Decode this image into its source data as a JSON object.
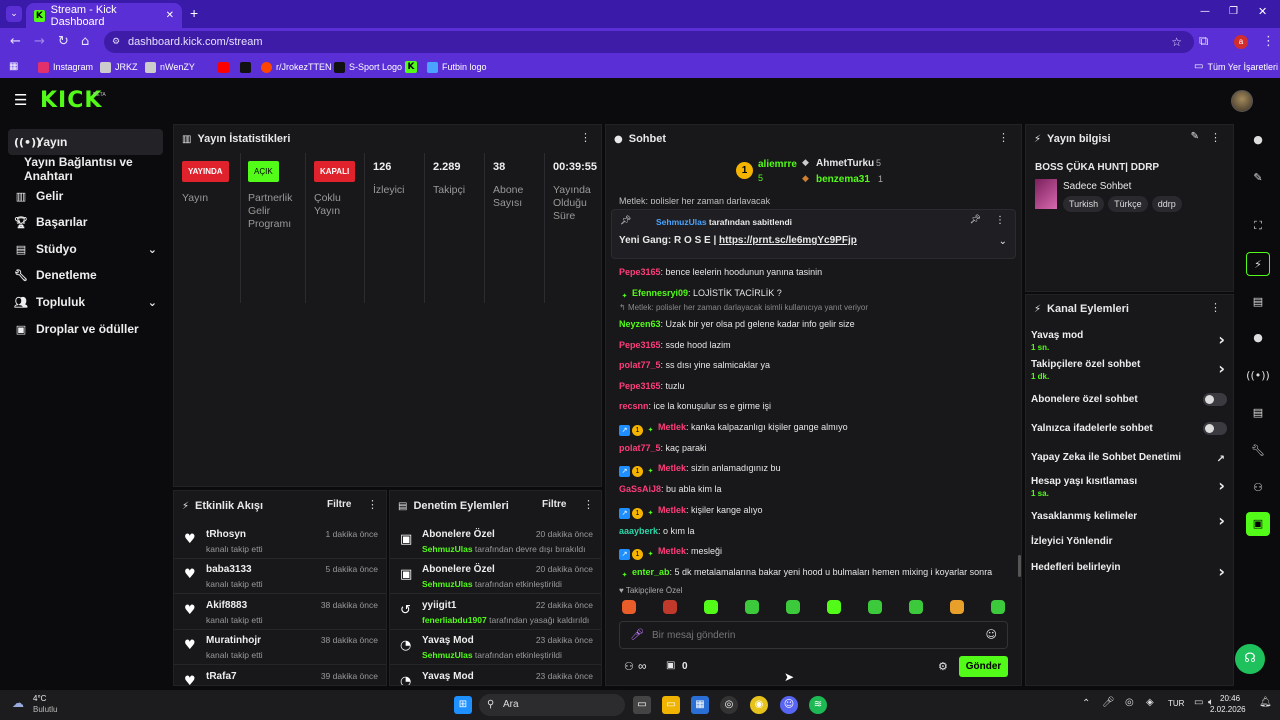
{
  "browser": {
    "tab_title": "Stream - Kick Dashboard",
    "new_tab": "+",
    "url": "dashboard.kick.com/stream",
    "profile_initial": "a",
    "bookmarks": [
      "Instagram",
      "JRKZ",
      "nWenZY",
      "r/JrokezTTEN",
      "S-Sport Logo",
      "Futbin logo"
    ],
    "all_bookmarks": "Tüm Yer İşaretleri"
  },
  "app": {
    "logo": "KICK",
    "beta": "BETA"
  },
  "sidebar": {
    "items": [
      {
        "label": "Yayın",
        "icon": "stream-icon"
      },
      {
        "label": "Yayın Bağlantısı ve Anahtarı",
        "icon": ""
      },
      {
        "label": "Gelir",
        "icon": "revenue-icon"
      },
      {
        "label": "Başarılar",
        "icon": "trophy-icon"
      },
      {
        "label": "Stüdyo",
        "icon": "studio-icon"
      },
      {
        "label": "Denetleme",
        "icon": "wrench-icon"
      },
      {
        "label": "Topluluk",
        "icon": "community-icon"
      },
      {
        "label": "Droplar ve ödüller",
        "icon": "gift-icon"
      }
    ]
  },
  "stats": {
    "title": "Yayın İstatistikleri",
    "cols": [
      {
        "badge": "YAYINDA",
        "badge_color": "#e0222d",
        "label": "Yayın"
      },
      {
        "badge": "AÇIK",
        "badge_color": "#53fc18",
        "label": "Partnerlik Gelir Programı"
      },
      {
        "badge": "KAPALI",
        "badge_color": "#e0222d",
        "label": "Çoklu Yayın"
      },
      {
        "value": "126",
        "label": "İzleyici"
      },
      {
        "value": "2.289",
        "label": "Takipçi"
      },
      {
        "value": "38",
        "label": "Abone Sayısı"
      },
      {
        "value": "00:39:55",
        "label": "Yayında Olduğu Süre"
      }
    ]
  },
  "activity": {
    "title": "Etkinlik Akışı",
    "filter": "Filtre",
    "rows": [
      {
        "name": "tRhosyn",
        "sub": "kanalı takip etti",
        "time": "1 dakika önce"
      },
      {
        "name": "baba3133",
        "sub": "kanalı takip etti",
        "time": "5 dakika önce"
      },
      {
        "name": "Akif8883",
        "sub": "kanalı takip etti",
        "time": "38 dakika önce"
      },
      {
        "name": "Muratinhojr",
        "sub": "kanalı takip etti",
        "time": "38 dakika önce"
      },
      {
        "name": "tRafa7",
        "sub": "",
        "time": "39 dakika önce"
      }
    ]
  },
  "modlog": {
    "title": "Denetim Eylemleri",
    "filter": "Filtre",
    "rows": [
      {
        "name": "Abonelere Özel",
        "actor": "SehmuzUlas",
        "sub": "tarafından devre dışı bırakıldı",
        "time": "20 dakika önce",
        "icon": "gift-icon"
      },
      {
        "name": "Abonelere Özel",
        "actor": "SehmuzUlas",
        "sub": "tarafından etkinleştirildi",
        "time": "20 dakika önce",
        "icon": "gift-icon"
      },
      {
        "name": "yyiigit1",
        "actor": "fenerliabdu1907",
        "sub": "tarafından yasağı kaldırıldı",
        "time": "22 dakika önce",
        "icon": "undo-icon"
      },
      {
        "name": "Yavaş Mod",
        "actor": "SehmuzUlas",
        "sub": "tarafından etkinleştirildi",
        "time": "23 dakika önce",
        "icon": "slow-icon"
      },
      {
        "name": "Yavaş Mod",
        "actor": "",
        "sub": "",
        "time": "23 dakika önce",
        "icon": "slow-icon"
      }
    ]
  },
  "chat": {
    "title": "Sohbet",
    "top": [
      {
        "rank": "1",
        "name": "aliemrre",
        "count": "5"
      },
      {
        "name": "AhmetTurku",
        "count": "5"
      },
      {
        "name": "benzema31",
        "count": "1"
      }
    ],
    "pinned_by": "SehmuzUlas",
    "pinned_by_text": "tarafından sabitlendi",
    "pinned_msg": "Yeni Gang: R O S E |",
    "pinned_link": "https://prnt.sc/le6mgYc9PFjp",
    "cut_top": "Metlek: polisler her zaman darlayacak",
    "reply_note": "Metlek: polisler her zaman darlayacak isimli kullanıcıya yanıt veriyor",
    "messages": [
      {
        "user": "Pepe3165",
        "color": "#ff3d7a",
        "text": ": bence leelerin hoodunun yanına tasinin"
      },
      {
        "user": "Efennesryi09",
        "color": "#53fc18",
        "text": ": LOJİSTİK TACİRLİK ?"
      },
      {
        "user": "Neyzen63",
        "color": "#53fc18",
        "text": ": Uzak bir yer olsa pd gelene kadar info gelir size"
      },
      {
        "user": "Pepe3165",
        "color": "#ff3d7a",
        "text": ": ssde hood lazim"
      },
      {
        "user": "polat77_5",
        "color": "#ff3d7a",
        "text": ": ss dısı yine salmicaklar ya"
      },
      {
        "user": "Pepe3165",
        "color": "#ff3d7a",
        "text": ": tuzlu"
      },
      {
        "user": "recsnn",
        "color": "#ff3d7a",
        "text": ": ice la konuşulur ss e girme işi"
      },
      {
        "user": "Metlek",
        "color": "#ff3d7a",
        "text": ": kanka kalpazanlıgı kişiler gange almıyo"
      },
      {
        "user": "polat77_5",
        "color": "#ff3d7a",
        "text": ": kaç paraki"
      },
      {
        "user": "Metlek",
        "color": "#ff3d7a",
        "text": ": sizin anlamadıgınız bu"
      },
      {
        "user": "GaSsAiJ8",
        "color": "#ff3d7a",
        "text": ": bu abla kim la"
      },
      {
        "user": "Metlek",
        "color": "#ff3d7a",
        "text": ": kişiler kange alıyo"
      },
      {
        "user": "aaayberk",
        "color": "#2ed6a8",
        "text": ": o kım la"
      },
      {
        "user": "Metlek",
        "color": "#ff3d7a",
        "text": ": mesleği"
      },
      {
        "user": "enter_ab",
        "color": "#53fc18",
        "text": ": 5 dk metalamalarına bakar yeni hood u bulmaları hemen mixing i koyarlar sonra"
      }
    ],
    "followers_only": "Takipçilere Özel",
    "input_placeholder": "Bir mesaj gönderin",
    "infinity": "∞",
    "count": "0",
    "send": "Gönder"
  },
  "info": {
    "title": "Yayın bilgisi",
    "stream_title": "BOSS ÇÜKA HUNT| DDRP",
    "category": "Sadece Sohbet",
    "tags": [
      "Turkish",
      "Türkçe",
      "ddrp"
    ]
  },
  "actions": {
    "title": "Kanal Eylemleri",
    "items": [
      {
        "label": "Yavaş mod",
        "sub": "1 sn.",
        "kind": "arrow"
      },
      {
        "label": "Takipçilere özel sohbet",
        "sub": "1 dk.",
        "kind": "arrow"
      },
      {
        "label": "Abonelere özel sohbet",
        "sub": "",
        "kind": "toggle"
      },
      {
        "label": "Yalnızca ifadelerle sohbet",
        "sub": "",
        "kind": "toggle"
      },
      {
        "label": "Yapay Zeka ile Sohbet Denetimi",
        "sub": "",
        "kind": "ext"
      },
      {
        "label": "Hesap yaşı kısıtlaması",
        "sub": "1 sa.",
        "kind": "arrow"
      },
      {
        "label": "Yasaklanmış kelimeler",
        "sub": "",
        "kind": "arrow"
      },
      {
        "label": "İzleyici Yönlendir",
        "sub": "",
        "kind": "none"
      },
      {
        "label": "Hedefleri belirleyin",
        "sub": "",
        "kind": "arrow"
      }
    ]
  },
  "taskbar": {
    "weather_temp": "4°C",
    "weather_desc": "Bulutlu",
    "search": "Ara",
    "lang": "TUR",
    "time": "20:46",
    "date": "2.02.2026"
  }
}
